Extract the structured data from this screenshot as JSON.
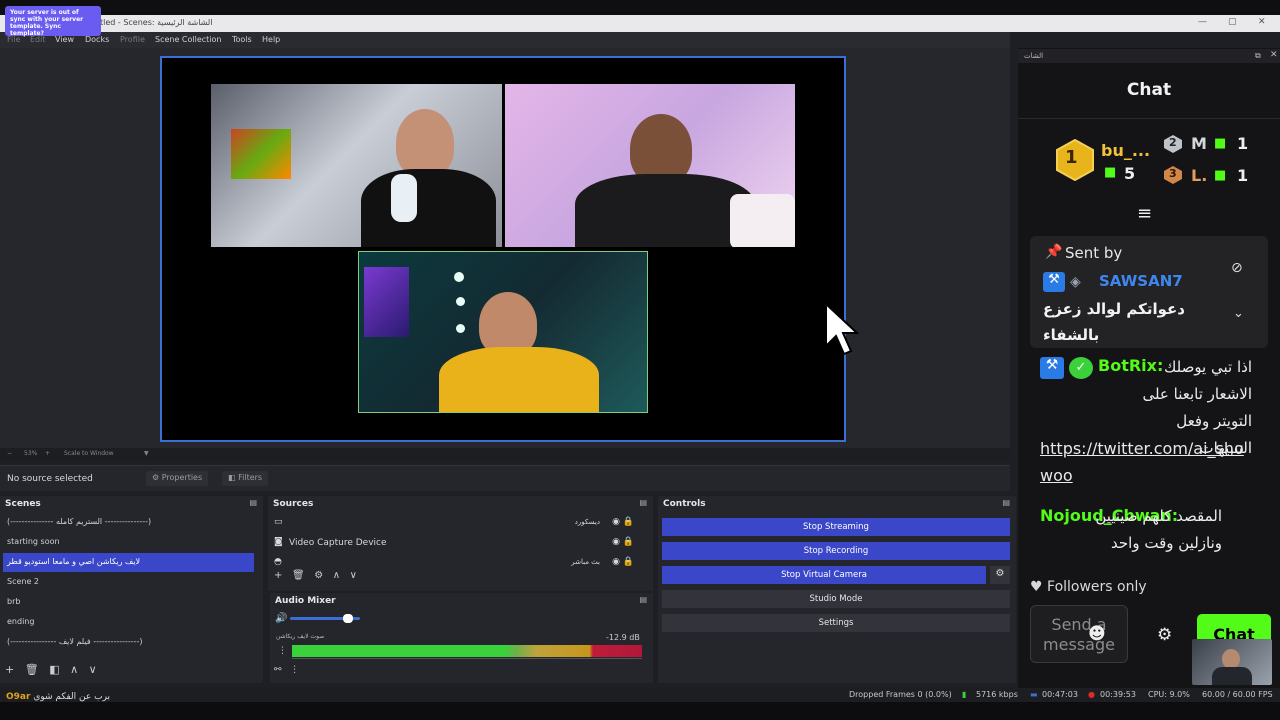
{
  "notification": {
    "text": "Your server is out of sync with your server template. Sync template?"
  },
  "window": {
    "title": "tled - Scenes: الشاشة الرئيسية",
    "minimize": "—",
    "maximize": "▢",
    "close": "✕"
  },
  "menu": {
    "file": "File",
    "edit": "Edit",
    "view": "View",
    "docks": "Docks",
    "profile": "Profile",
    "scene_collection": "Scene Collection",
    "tools": "Tools",
    "help": "Help"
  },
  "zoom": {
    "level": "53%",
    "mode": "Scale to Window"
  },
  "properties_bar": {
    "no_source": "No source selected",
    "properties": "Properties",
    "filters": "Filters"
  },
  "scenes": {
    "title": "Scenes",
    "items": [
      {
        "label": "(--------------- الستريم كامله ---------------)"
      },
      {
        "label": "starting soon"
      },
      {
        "label": "لايف ريكاشن اصي و مامعا  استوديو قطر"
      },
      {
        "label": "Scene 2"
      },
      {
        "label": "brb"
      },
      {
        "label": "ending"
      },
      {
        "label": "(---------------- فيلم لايف ----------------)"
      }
    ]
  },
  "sources": {
    "title": "Sources",
    "items": [
      {
        "label": "ديسكورد"
      },
      {
        "label": "Video Capture Device"
      },
      {
        "label": "بث مباشر"
      }
    ]
  },
  "mixer": {
    "title": "Audio Mixer",
    "channel": "صوت لايف ريكاشن",
    "db": "-12.9 dB"
  },
  "controls": {
    "title": "Controls",
    "stop_streaming": "Stop Streaming",
    "stop_recording": "Stop Recording",
    "stop_virtual_camera": "Stop Virtual Camera",
    "studio_mode": "Studio Mode",
    "settings": "Settings"
  },
  "status": {
    "dropped": "Dropped Frames 0 (0.0%)",
    "kbps": "5716 kbps",
    "stream_time": "00:47:03",
    "rec_time": "00:39:53",
    "cpu": "CPU: 9.0%",
    "fps": "60.00 / 60.00 FPS"
  },
  "bottom": {
    "user": "O9ar",
    "text": "برب عن الفكم شوي"
  },
  "chat": {
    "window_title": "الشات",
    "title": "Chat",
    "leaderboard": {
      "first": {
        "rank": "1",
        "name": "bu_...",
        "gifts": "5"
      },
      "second": {
        "rank": "2",
        "name": "M",
        "gifts": "1"
      },
      "third": {
        "rank": "3",
        "name": "L.",
        "gifts": "1"
      }
    },
    "pinned": {
      "label": "Sent by",
      "user": "SAWSAN7",
      "message": "دعواتكم لوالد زعزع بالشفاء"
    },
    "messages": [
      {
        "user": "BotRix:",
        "text": "اذا تبي يوصلك الاشعار تابعنا على التويتر وفعل التنبيهات",
        "link_1": "https://twitter.com/ai_sho",
        "link_2": "woo"
      },
      {
        "user": "Nojoud_Chwan:",
        "text": "المقصد كلهم صينيين ونازلين وقت واحد"
      }
    ],
    "followers_only": "Followers only",
    "send_placeholder": "Send a message",
    "chat_button": "Chat"
  },
  "colors": {
    "accent": "#3b47c9",
    "kick_green": "#53fc18",
    "preview_border": "#3b6fd6"
  }
}
